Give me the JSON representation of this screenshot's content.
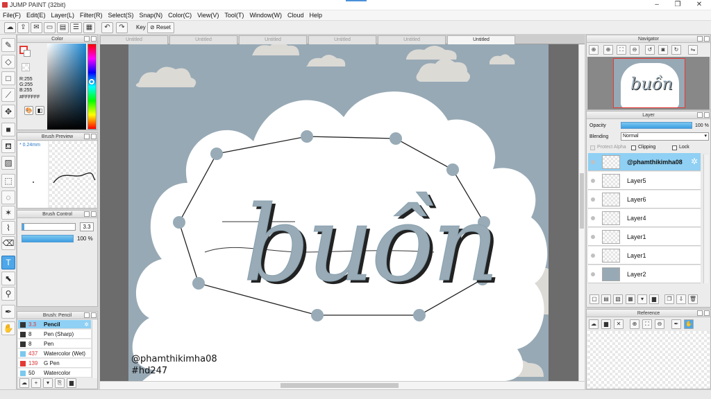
{
  "window": {
    "title": "JUMP PAINT (32bit)"
  },
  "menu": [
    "File(F)",
    "Edit(E)",
    "Layer(L)",
    "Filter(R)",
    "Select(S)",
    "Snap(N)",
    "Color(C)",
    "View(V)",
    "Tool(T)",
    "Window(W)",
    "Cloud",
    "Help"
  ],
  "toolbar": {
    "key_label": "Key",
    "reset_label": "Reset"
  },
  "tabs": [
    "Untitled",
    "Untitled",
    "Untitled",
    "Untitled",
    "Untitled",
    "Untitled"
  ],
  "active_tab_index": 5,
  "color_panel": {
    "title": "Color",
    "r": "R:255",
    "g": "G:255",
    "b": "B:255",
    "hex": "#FFFFFF",
    "main_color": "#ffffff",
    "accent_color": "#e53935"
  },
  "brush_preview": {
    "title": "Brush Preview",
    "size_label": "0.24mm"
  },
  "brush_control": {
    "title": "Brush Control",
    "size_value": "3.3",
    "opacity_value": "100 %"
  },
  "brush_list": {
    "title": "Brush: Pencil",
    "items": [
      {
        "size": "3.3",
        "name": "Pencil",
        "color": "#333333",
        "selected": true
      },
      {
        "size": "8",
        "name": "Pen (Sharp)",
        "color": "#333333"
      },
      {
        "size": "8",
        "name": "Pen",
        "color": "#333333"
      },
      {
        "size": "437",
        "name": "Watercolor (Wet)",
        "color": "#7cc8ee"
      },
      {
        "size": "139",
        "name": "G Pen",
        "color": "#e53935"
      },
      {
        "size": "50",
        "name": "Watercolor",
        "color": "#7cc8ee"
      }
    ]
  },
  "canvas": {
    "lettering": "buồn",
    "caption_line1": "@phamthikimha08",
    "caption_line2": "#hd247",
    "background_color": "#97a9b5",
    "cloud_color": "#ffffff",
    "accent_shadow_color": "#98abb7"
  },
  "navigator": {
    "title": "Navigator"
  },
  "layer_panel": {
    "title": "Layer",
    "opacity_label": "Opacity",
    "opacity_value": "100 %",
    "opacity_fraction": 1.0,
    "blending_label": "Blending",
    "blending_value": "Normal",
    "protect_alpha_label": "Protect Alpha",
    "clipping_label": "Clipping",
    "lock_label": "Lock",
    "layers": [
      {
        "name": "@phamthikimha08",
        "selected": true
      },
      {
        "name": "Layer5"
      },
      {
        "name": "Layer6"
      },
      {
        "name": "Layer4"
      },
      {
        "name": "Layer1"
      },
      {
        "name": "Layer1"
      },
      {
        "name": "Layer2"
      }
    ]
  },
  "reference_panel": {
    "title": "Reference"
  }
}
